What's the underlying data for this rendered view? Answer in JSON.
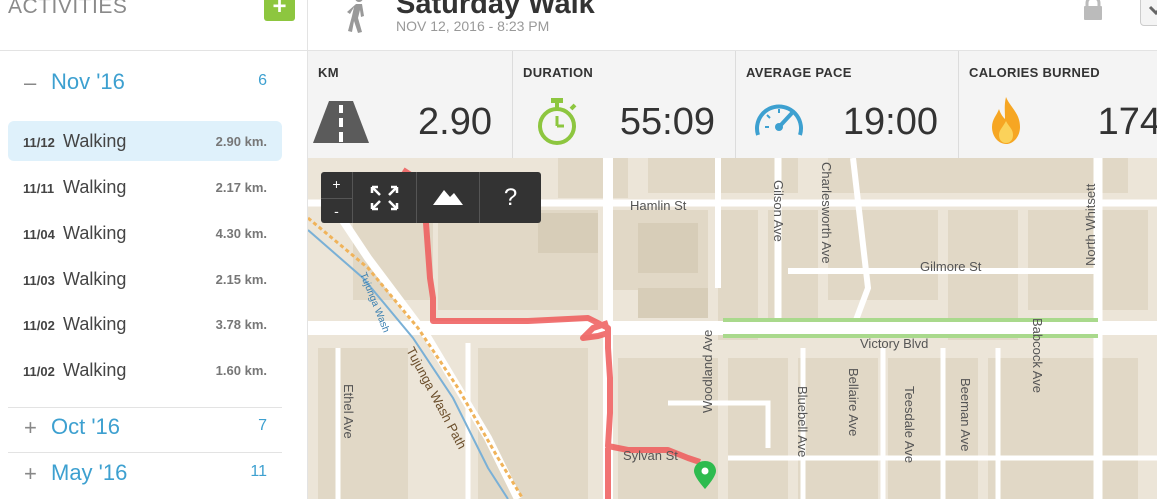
{
  "sidebar": {
    "title": "ACTIVITIES",
    "add_label": "+",
    "months": [
      {
        "sign": "–",
        "name": "Nov '16",
        "count": "6"
      },
      {
        "sign": "+",
        "name": "Oct '16",
        "count": "7"
      },
      {
        "sign": "+",
        "name": "May '16",
        "count": "11"
      }
    ],
    "activities": [
      {
        "date": "11/12",
        "type": "Walking",
        "dist": "2.90 km."
      },
      {
        "date": "11/11",
        "type": "Walking",
        "dist": "2.17 km."
      },
      {
        "date": "11/04",
        "type": "Walking",
        "dist": "4.30 km."
      },
      {
        "date": "11/03",
        "type": "Walking",
        "dist": "2.15 km."
      },
      {
        "date": "11/02",
        "type": "Walking",
        "dist": "3.78 km."
      },
      {
        "date": "11/02",
        "type": "Walking",
        "dist": "1.60 km."
      }
    ]
  },
  "header": {
    "title": "Saturday Walk",
    "subtitle": "NOV 12, 2016  -  8:23 PM"
  },
  "stats": [
    {
      "label": "KM",
      "value": "2.90",
      "icon": "road-icon"
    },
    {
      "label": "DURATION",
      "value": "55:09",
      "icon": "stopwatch-icon"
    },
    {
      "label": "AVERAGE PACE",
      "value": "19:00",
      "icon": "speedometer-icon"
    },
    {
      "label": "CALORIES BURNED",
      "value": "174",
      "icon": "flame-icon"
    }
  ],
  "map": {
    "controls": {
      "zoom_in": "+",
      "zoom_out": "-",
      "help": "?"
    },
    "streets": {
      "hamlin": "Hamlin St",
      "gilmore": "Gilmore St",
      "victory": "Victory Blvd",
      "sylvan": "Sylvan St",
      "gilson": "Gilson Ave",
      "charlesworth": "Charlesworth Ave",
      "north_whitsett": "North Whitsett",
      "babcock": "Babcock Ave",
      "ethel": "Ethel Ave",
      "tujunga_wash": "Tujunga Wash",
      "tujunga_path": "Tujunga Wash Path",
      "woodland": "Woodland Ave",
      "bluebell": "Bluebell Ave",
      "bellaire": "Bellaire Ave",
      "teesdale": "Teesdale Ave",
      "beeman": "Beeman Ave"
    },
    "colors": {
      "route": "#ef5a5a",
      "base": "#ece5d8",
      "block": "#e1d8c6",
      "road": "#ffffff",
      "greenway": "#a9d98c"
    }
  }
}
